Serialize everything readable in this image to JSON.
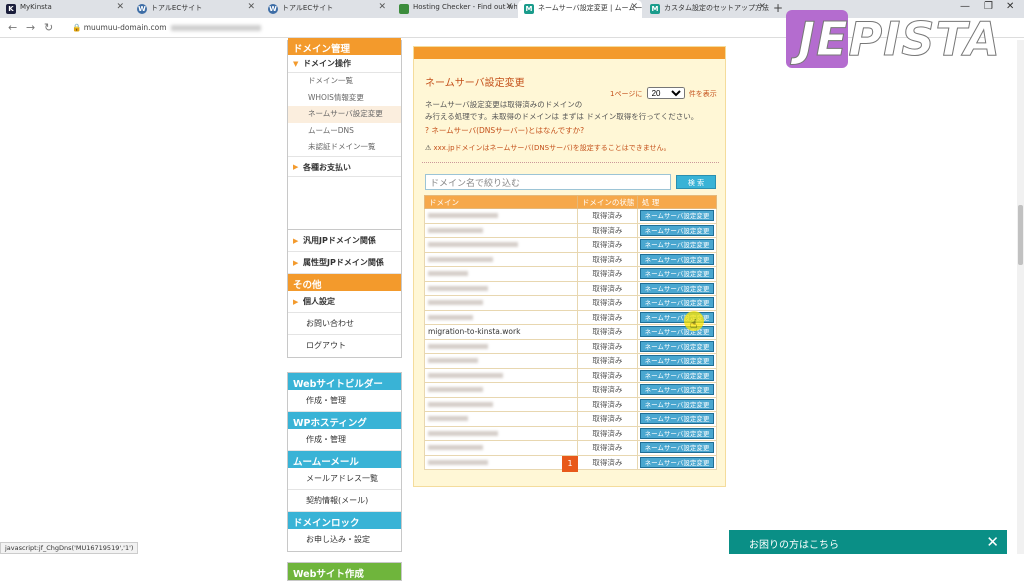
{
  "browser": {
    "tabs": [
      {
        "title": "MyKinsta",
        "fav": "K",
        "color": "#1b1e3c"
      },
      {
        "title": "トアルECサイト",
        "fav": "W",
        "color": "#3d6da6"
      },
      {
        "title": "トアルECサイト",
        "fav": "W",
        "color": "#3d6da6"
      },
      {
        "title": "Hosting Checker - Find out who",
        "fav": "",
        "color": "#3c8c3c"
      },
      {
        "title": "ネームサーバ設定変更 | ムームードメイン",
        "fav": "M",
        "color": "#1a9c8c"
      },
      {
        "title": "カスタム設定のセットアップ方法 - ムー",
        "fav": "M",
        "color": "#1a9c8c"
      }
    ],
    "new_tab": "+",
    "back": "←",
    "forward": "→",
    "reload": "C",
    "url": "muumuu-domain.com",
    "logo_text": "JEPISTA"
  },
  "sidebar": {
    "domain_header": "ドメイン管理",
    "domain_ops": "ドメイン操作",
    "sub_items": [
      "ドメイン一覧",
      "WHOIS情報変更",
      "ネームサーバ設定変更",
      "ムームーDNS",
      "未認証ドメイン一覧"
    ],
    "groups": [
      "各種お支払い",
      "汎用JPドメイン関係",
      "属性型JPドメイン関係"
    ],
    "other_header": "その他",
    "other_items": [
      "個人設定",
      "お問い合わせ",
      "ログアウト"
    ],
    "builder_header": "Webサイトビルダー",
    "builder_item": "作成・管理",
    "wp_header": "WPホスティング",
    "wp_item": "作成・管理",
    "mail_header": "ムームーメール",
    "mail_items": [
      "メールアドレス一覧",
      "契約情報(メール)"
    ],
    "lock_header": "ドメインロック",
    "lock_item": "お申し込み・設定",
    "web_header": "Webサイト作成"
  },
  "main": {
    "title": "ネームサーバ設定変更",
    "per_page_prefix": "1ページに",
    "per_page_value": "20",
    "per_page_suffix": "件を表示",
    "desc1": "ネームサーバ設定変更は取得済みのドメインの",
    "desc2": "み行える処理です。未取得のドメインは まずは ドメイン取得を行ってください。",
    "help_link": "ネームサーバ(DNSサーバー)とはなんですか?",
    "warning": "xxx.jpドメインはネームサーバ(DNSサーバ)を設定することはできません。",
    "search_placeholder": "ドメイン名で絞り込む",
    "search_button": "検 索",
    "col_domain": "ドメイン",
    "col_status": "ドメインの状態",
    "col_action": "処 理",
    "status_acquired": "取得済み",
    "change_button": "ネームサーバ設定変更",
    "visible_domain": "migration-to-kinsta.work",
    "page": "1"
  },
  "status_text": "javascript:jf_ChgDns('MU16719519','1')",
  "help_widget": {
    "label": "お困りの方はこちら",
    "close": "✕"
  }
}
